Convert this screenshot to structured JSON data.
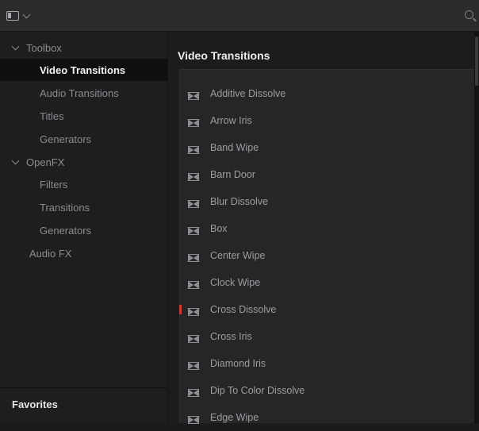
{
  "header": {
    "toggle_icon": "panel-layout-icon",
    "search_icon": "search-icon"
  },
  "sidebar": {
    "items": [
      {
        "label": "Toolbox",
        "expandable": true,
        "expanded": true,
        "level": 0
      },
      {
        "label": "Video Transitions",
        "level": 1,
        "selected": true
      },
      {
        "label": "Audio Transitions",
        "level": 1
      },
      {
        "label": "Titles",
        "level": 1
      },
      {
        "label": "Generators",
        "level": 1
      },
      {
        "label": "OpenFX",
        "expandable": true,
        "expanded": true,
        "level": 0
      },
      {
        "label": "Filters",
        "level": 1
      },
      {
        "label": "Transitions",
        "level": 1
      },
      {
        "label": "Generators",
        "level": 1
      },
      {
        "label": "Audio FX",
        "level": 0
      }
    ],
    "favorites_label": "Favorites"
  },
  "content": {
    "title": "Video Transitions",
    "items": [
      {
        "label": "Additive Dissolve"
      },
      {
        "label": "Arrow Iris"
      },
      {
        "label": "Band Wipe"
      },
      {
        "label": "Barn Door"
      },
      {
        "label": "Blur Dissolve"
      },
      {
        "label": "Box"
      },
      {
        "label": "Center Wipe"
      },
      {
        "label": "Clock Wipe"
      },
      {
        "label": "Cross Dissolve",
        "marked": true
      },
      {
        "label": "Cross Iris"
      },
      {
        "label": "Diamond Iris"
      },
      {
        "label": "Dip To Color Dissolve"
      },
      {
        "label": "Edge Wipe"
      }
    ]
  },
  "colors": {
    "marker": "#d13a2e",
    "selected_bg": "#0f0f11",
    "panel_bg": "#262628"
  }
}
